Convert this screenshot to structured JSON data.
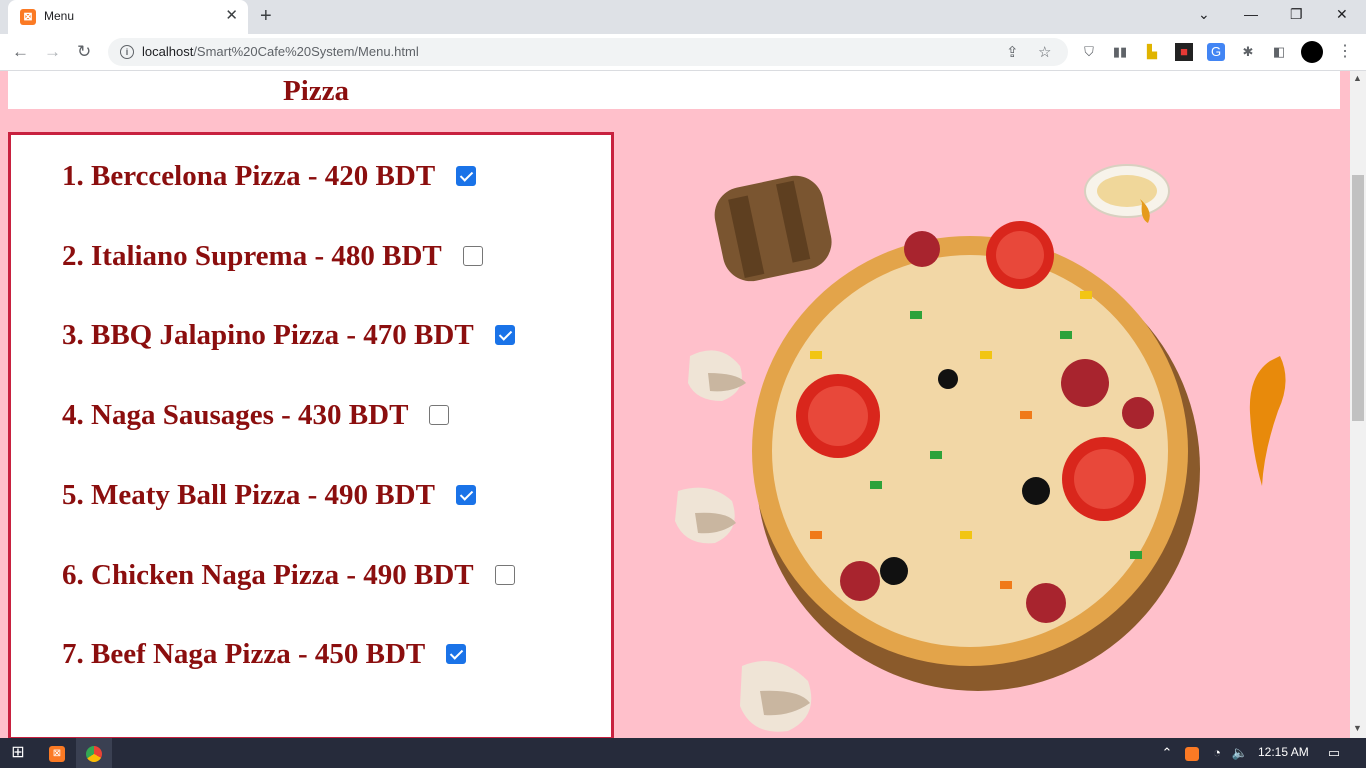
{
  "browser": {
    "tab_title": "Menu",
    "tab_close": "✕",
    "new_tab": "+",
    "url_host": "localhost",
    "url_path": "/Smart%20Cafe%20System/Menu.html"
  },
  "page": {
    "section_title": "Pizza",
    "items": [
      {
        "label": "1. Berccelona Pizza - 420 BDT",
        "checked": true
      },
      {
        "label": "2. Italiano Suprema - 480 BDT",
        "checked": false
      },
      {
        "label": "3. BBQ Jalapino Pizza - 470 BDT",
        "checked": true
      },
      {
        "label": "4. Naga Sausages - 430 BDT",
        "checked": false
      },
      {
        "label": "5. Meaty Ball Pizza - 490 BDT",
        "checked": true
      },
      {
        "label": "6. Chicken Naga Pizza - 490 BDT",
        "checked": false
      },
      {
        "label": "7. Beef Naga Pizza - 450 BDT",
        "checked": true
      }
    ]
  },
  "taskbar": {
    "clock": "12:15 AM"
  },
  "colors": {
    "page_bg": "#ffc0cb",
    "text_red": "#8b0e0e",
    "border_red": "#c8213f",
    "checkbox_blue": "#1a73e8"
  }
}
